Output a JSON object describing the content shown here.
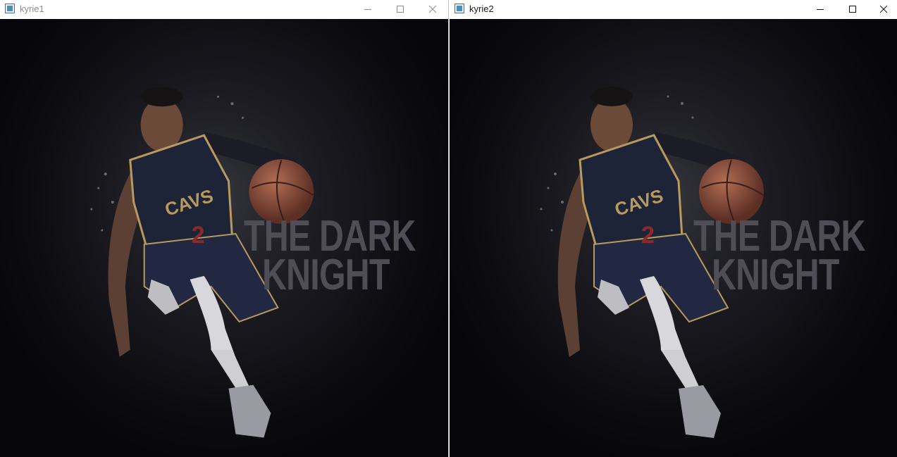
{
  "windows": [
    {
      "title": "kyrie1",
      "focused": false,
      "controls": {
        "minimize": "minimize-icon",
        "maximize": "maximize-icon",
        "close": "close-icon"
      },
      "image": {
        "text_line1": "THE DARK",
        "text_line2": "KNIGHT",
        "jersey_text": "CAVS",
        "jersey_number": "2"
      }
    },
    {
      "title": "kyrie2",
      "focused": true,
      "controls": {
        "minimize": "minimize-icon",
        "maximize": "maximize-icon",
        "close": "close-icon"
      },
      "image": {
        "text_line1": "THE DARK",
        "text_line2": "KNIGHT",
        "jersey_text": "CAVS",
        "jersey_number": "2"
      }
    }
  ],
  "colors": {
    "background": "#0b0b10",
    "jersey": "#1e2438",
    "jersey_trim": "#b89a5e",
    "ball": "#8a4a38",
    "overlay_text": "#4f4e56"
  }
}
